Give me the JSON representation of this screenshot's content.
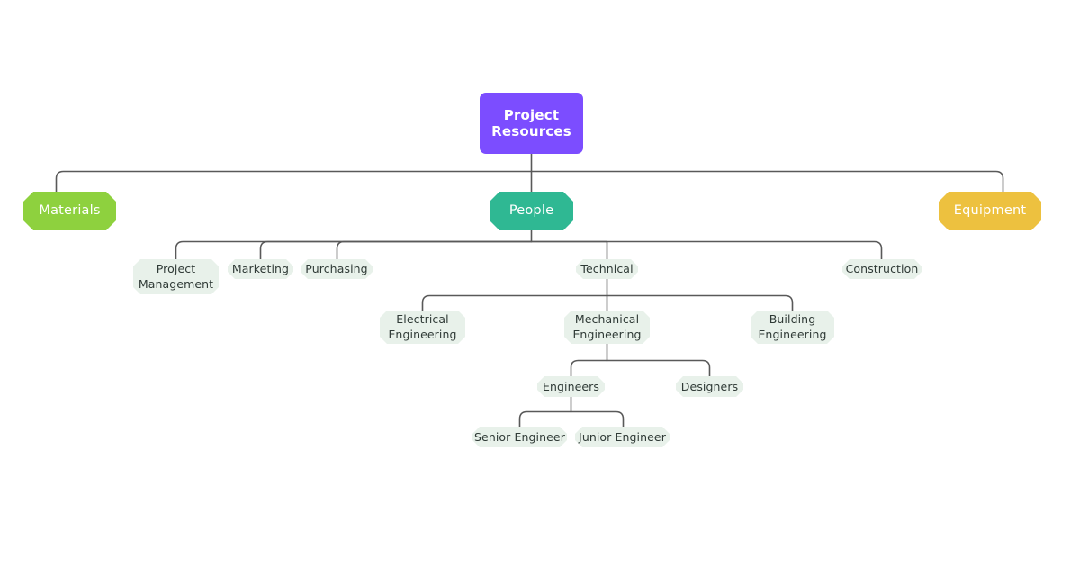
{
  "diagram": {
    "title": "Project Resources",
    "type": "mind-map",
    "background_color": "#ffffff",
    "edge_color": "#595959",
    "edge_width": 1.6,
    "edge_corner_radius": 8
  },
  "palette": {
    "root_fill": "#7c4dff",
    "root_text": "#ffffff",
    "materials_fill": "#8ed13e",
    "people_fill": "#2fb893",
    "equipment_fill": "#edc13f",
    "leaf_fill": "#e8f1ea",
    "leaf_text": "#2f3a36",
    "branch_text": "#ffffff"
  },
  "nodes": {
    "root": {
      "label": "Project\nResources"
    },
    "materials": {
      "label": "Materials"
    },
    "people": {
      "label": "People"
    },
    "equipment": {
      "label": "Equipment"
    },
    "project_management": {
      "label": "Project\nManagement"
    },
    "marketing": {
      "label": "Marketing"
    },
    "purchasing": {
      "label": "Purchasing"
    },
    "technical": {
      "label": "Technical"
    },
    "construction": {
      "label": "Construction"
    },
    "electrical_engineering": {
      "label": "Electrical\nEngineering"
    },
    "mechanical_engineering": {
      "label": "Mechanical\nEngineering"
    },
    "building_engineering": {
      "label": "Building\nEngineering"
    },
    "engineers": {
      "label": "Engineers"
    },
    "designers": {
      "label": "Designers"
    },
    "senior_engineer": {
      "label": "Senior Engineer"
    },
    "junior_engineer": {
      "label": "Junior Engineer"
    }
  },
  "chart_data": {
    "type": "tree",
    "title": "Project Resources",
    "root": {
      "name": "Project Resources",
      "level": 0,
      "children": [
        {
          "name": "Materials",
          "level": 1,
          "children": []
        },
        {
          "name": "People",
          "level": 1,
          "children": [
            {
              "name": "Project Management",
              "level": 2,
              "children": []
            },
            {
              "name": "Marketing",
              "level": 2,
              "children": []
            },
            {
              "name": "Purchasing",
              "level": 2,
              "children": []
            },
            {
              "name": "Technical",
              "level": 2,
              "children": [
                {
                  "name": "Electrical Engineering",
                  "level": 3,
                  "children": []
                },
                {
                  "name": "Mechanical Engineering",
                  "level": 3,
                  "children": [
                    {
                      "name": "Engineers",
                      "level": 4,
                      "children": [
                        {
                          "name": "Senior Engineer",
                          "level": 5,
                          "children": []
                        },
                        {
                          "name": "Junior Engineer",
                          "level": 5,
                          "children": []
                        }
                      ]
                    },
                    {
                      "name": "Designers",
                      "level": 4,
                      "children": []
                    }
                  ]
                },
                {
                  "name": "Building Engineering",
                  "level": 3,
                  "children": []
                }
              ]
            },
            {
              "name": "Construction",
              "level": 2,
              "children": []
            }
          ]
        },
        {
          "name": "Equipment",
          "level": 1,
          "children": []
        }
      ]
    },
    "node_count": 16,
    "depth": 6
  }
}
